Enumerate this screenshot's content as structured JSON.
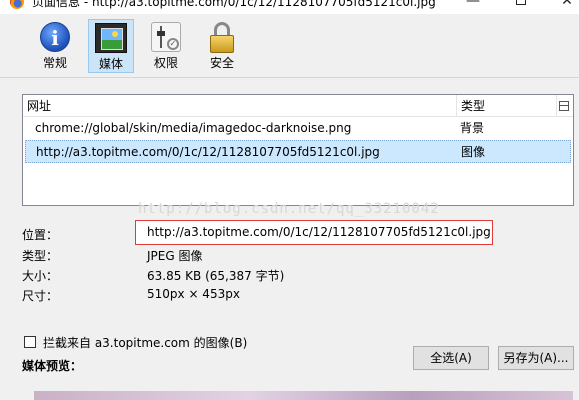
{
  "window": {
    "title": "页面信息 - http://a3.topitme.com/0/1c/12/1128107705fd5121c0l.jpg",
    "minimize": "—",
    "close": "✕"
  },
  "toolbar": {
    "tabs": [
      {
        "label": "常规",
        "icon": "info-icon"
      },
      {
        "label": "媒体",
        "icon": "media-icon",
        "active": true
      },
      {
        "label": "权限",
        "icon": "permissions-icon"
      },
      {
        "label": "安全",
        "icon": "lock-icon"
      }
    ]
  },
  "media_list": {
    "columns": {
      "address": "网址",
      "type": "类型"
    },
    "rows": [
      {
        "address": "chrome://global/skin/media/imagedoc-darknoise.png",
        "type": "背景"
      },
      {
        "address": "http://a3.topitme.com/0/1c/12/1128107705fd5121c0l.jpg",
        "type": "图像",
        "selected": true
      }
    ]
  },
  "watermark": "http://blog.csdn.net/qq_33210042",
  "properties": {
    "location_label": "位置：",
    "location_value": "http://a3.topitme.com/0/1c/12/1128107705fd5121c0l.jpg",
    "type_label": "类型：",
    "type_value": "JPEG 图像",
    "size_label": "大小：",
    "size_value": "63.85 KB (65,387 字节)",
    "dimensions_label": "尺寸：",
    "dimensions_value": "510px × 453px"
  },
  "block_images": {
    "label": "拦截来自 a3.topitme.com 的图像(B)",
    "checked": false
  },
  "buttons": {
    "select_all": "全选(A)",
    "save_as": "另存为(A)..."
  },
  "preview": {
    "label": "媒体预览："
  }
}
